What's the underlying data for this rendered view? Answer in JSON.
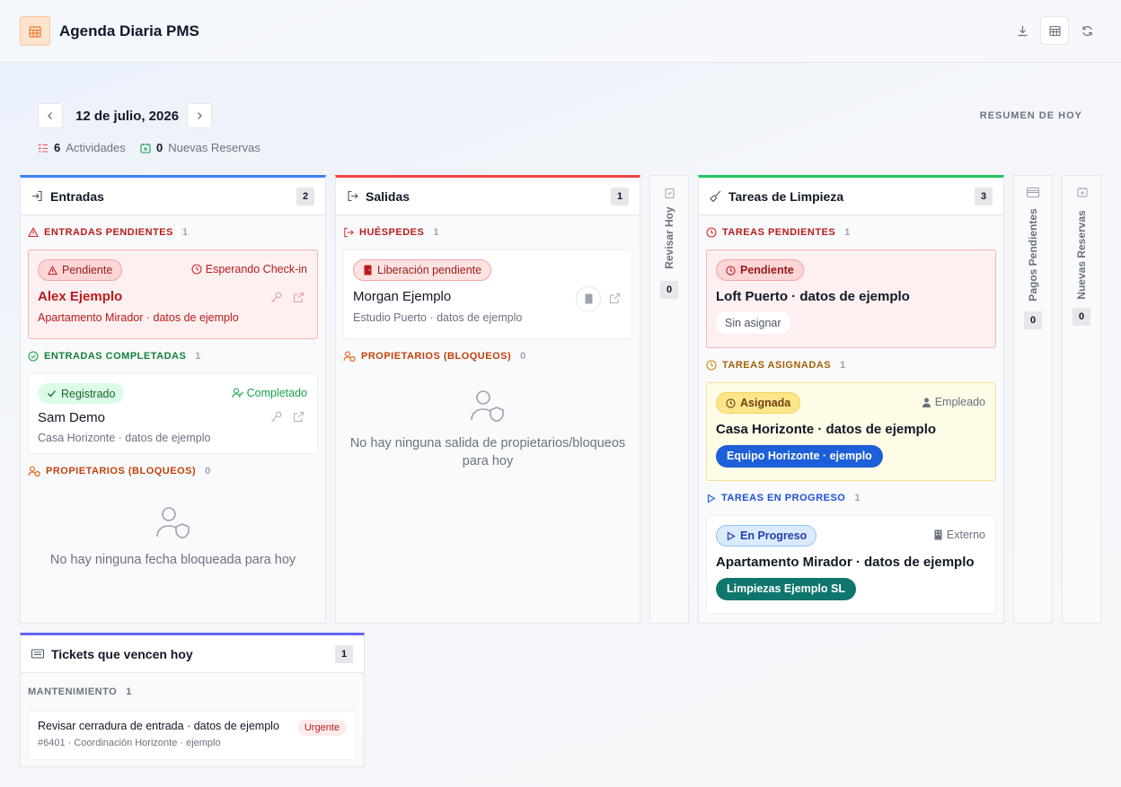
{
  "header": {
    "title": "Agenda Diaria PMS",
    "icons": [
      "calendar-grid-icon",
      "download-icon",
      "table-icon",
      "refresh-icon"
    ]
  },
  "toolbar": {
    "date": "12 de julio, 2026",
    "summary_link": "RESUMEN DE HOY",
    "stats": [
      {
        "value": "6",
        "label": "Actividades"
      },
      {
        "value": "0",
        "label": "Nuevas Reservas"
      }
    ]
  },
  "colors": {
    "entradas": "#3b82f6",
    "salidas": "#ef4444",
    "limpieza": "#22c55e",
    "tickets": "#6366f1"
  },
  "entradas": {
    "title": "Entradas",
    "count": "2",
    "pending": {
      "title": "ENTRADAS PENDIENTES",
      "count": "1",
      "card": {
        "status": "Pendiente",
        "meta": "Esperando Check-in",
        "guest": "Alex Ejemplo",
        "property": "Apartamento Mirador · datos de ejemplo"
      }
    },
    "completed": {
      "title": "ENTRADAS COMPLETADAS",
      "count": "1",
      "card": {
        "status": "Registrado",
        "meta": "Completado",
        "guest": "Sam Demo",
        "property": "Casa Horizonte · datos de ejemplo"
      }
    },
    "owners": {
      "title": "PROPIETARIOS (BLOQUEOS)",
      "count": "0",
      "empty": "No hay ninguna fecha bloqueada para hoy"
    }
  },
  "salidas": {
    "title": "Salidas",
    "count": "1",
    "guests": {
      "title": "HUÉSPEDES",
      "count": "1",
      "card": {
        "status": "Liberación pendiente",
        "guest": "Morgan Ejemplo",
        "property": "Estudio Puerto · datos de ejemplo"
      }
    },
    "owners": {
      "title": "PROPIETARIOS (BLOQUEOS)",
      "count": "0",
      "empty": "No hay ninguna salida de propietarios/bloqueos para hoy"
    }
  },
  "revisar": {
    "label": "Revisar Hoy",
    "count": "0"
  },
  "limpieza": {
    "title": "Tareas de Limpieza",
    "count": "3",
    "pending": {
      "title": "TAREAS PENDIENTES",
      "count": "1",
      "card": {
        "status": "Pendiente",
        "property": "Loft Puerto · datos de ejemplo",
        "assignee": "Sin asignar"
      }
    },
    "assigned": {
      "title": "TAREAS ASIGNADAS",
      "count": "1",
      "card": {
        "status": "Asignada",
        "meta": "Empleado",
        "property": "Casa Horizonte · datos de ejemplo",
        "team": "Equipo Horizonte · ejemplo"
      }
    },
    "progress": {
      "title": "TAREAS EN PROGRESO",
      "count": "1",
      "card": {
        "status": "En Progreso",
        "meta": "Externo",
        "property": "Apartamento Mirador · datos de ejemplo",
        "team": "Limpiezas Ejemplo SL"
      }
    }
  },
  "pagos": {
    "label": "Pagos Pendientes",
    "count": "0"
  },
  "nuevas": {
    "label": "Nuevas Reservas",
    "count": "0"
  },
  "tickets": {
    "title": "Tickets que vencen hoy",
    "count": "1",
    "section": {
      "title": "MANTENIMIENTO",
      "count": "1"
    },
    "ticket": {
      "title": "Revisar cerradura de entrada · datos de ejemplo",
      "priority": "Urgente",
      "meta": "#6401 · Coordinación Horizonte · ejemplo"
    }
  }
}
